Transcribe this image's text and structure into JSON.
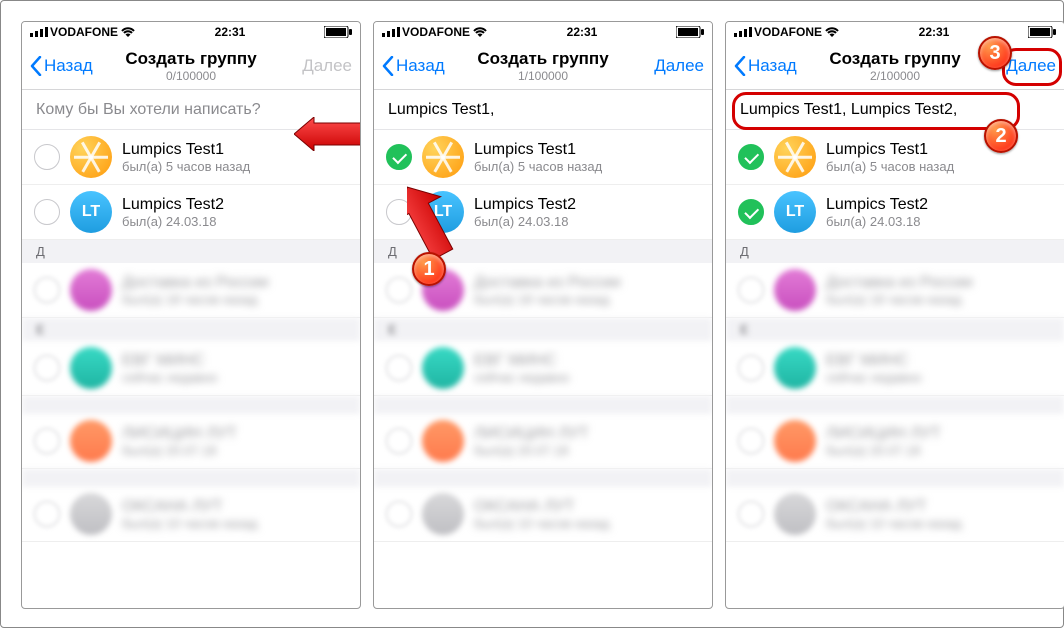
{
  "status": {
    "carrier": "VODAFONE",
    "time": "22:31"
  },
  "nav": {
    "back": "Назад",
    "title": "Создать группу",
    "next": "Далее",
    "count_total": "100000"
  },
  "search_placeholder": "Кому бы Вы хотели написать?",
  "selected_text_1": "Lumpics Test1,",
  "selected_text_2": "Lumpics Test1,  Lumpics Test2,",
  "contacts": {
    "c1_name": "Lumpics Test1",
    "c1_sub": "был(а) 5 часов назад",
    "c2_name": "Lumpics Test2",
    "c2_sub": "был(а) 24.03.18",
    "lt_initials": "LT"
  },
  "sections": {
    "letter_d": "Д",
    "letter_e": "E"
  },
  "blurred": {
    "b1n": "Доставка из России",
    "b1s": "был(а) 18 часов назад",
    "b2n": "ЕВГ МИНС",
    "b2s": "сейчас недавно",
    "b3n": "ЛИСИЦИН ЛУТ",
    "b3s": "был(а) 20.07.18",
    "b4n": "ОКСАНА ЛУТ",
    "b4s": "был(а) 10 часов назад"
  },
  "counts": {
    "p1": "0/100000",
    "p2": "1/100000",
    "p3": "2/100000"
  },
  "callouts": {
    "n1": "1",
    "n2": "2",
    "n3": "3"
  }
}
